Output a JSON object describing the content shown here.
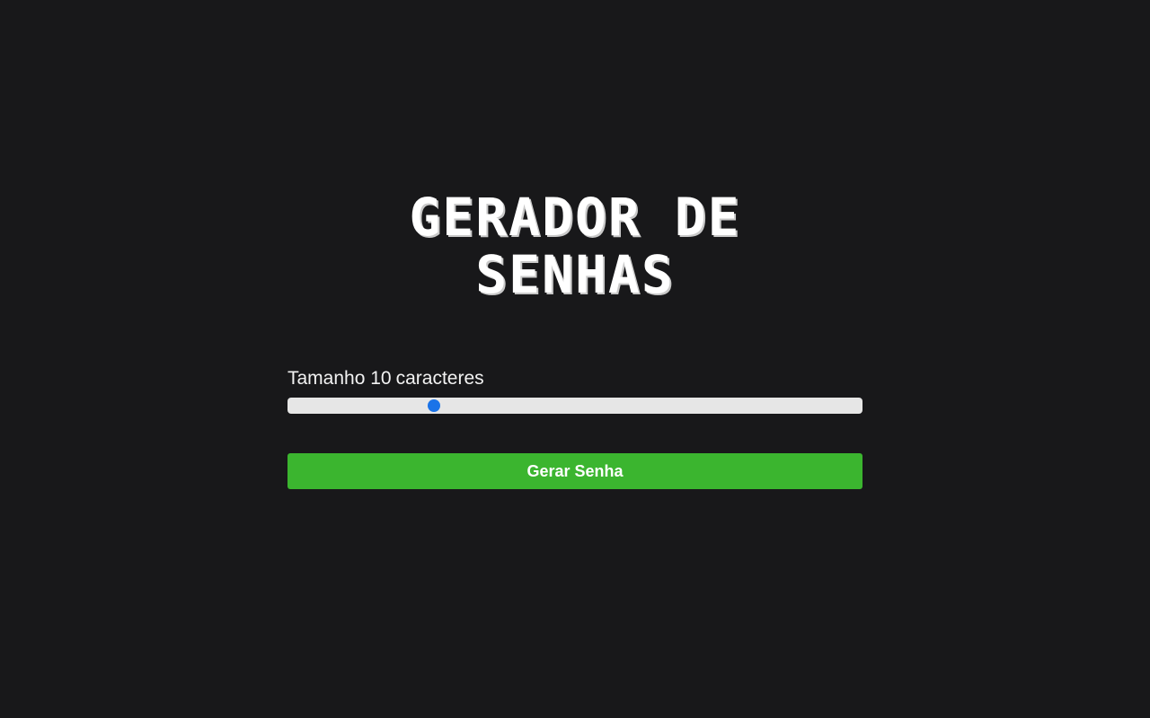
{
  "app": {
    "title_lines": [
      "GERADOR DE",
      "SENHAS"
    ]
  },
  "length_control": {
    "label_prefix": "Tamanho",
    "value": "10",
    "unit": "caracteres",
    "slider_fraction": 0.255,
    "thumb_color": "#1a73e8",
    "track_color": "#e6e6e6"
  },
  "actions": {
    "generate_label": "Gerar Senha",
    "generate_color": "#3bb52f"
  },
  "theme": {
    "background": "#18181a"
  }
}
